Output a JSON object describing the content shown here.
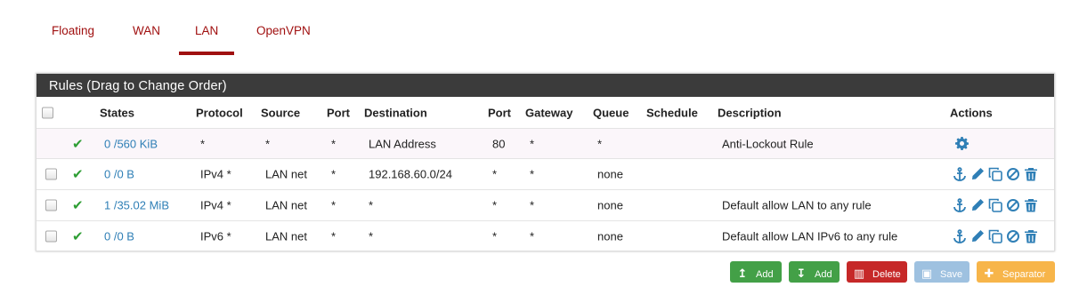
{
  "tabs": [
    {
      "label": "Floating",
      "active": false
    },
    {
      "label": "WAN",
      "active": false
    },
    {
      "label": "LAN",
      "active": true
    },
    {
      "label": "OpenVPN",
      "active": false
    }
  ],
  "panel": {
    "title": "Rules (Drag to Change Order)"
  },
  "columns": {
    "states": "States",
    "protocol": "Protocol",
    "source": "Source",
    "port": "Port",
    "destination": "Destination",
    "dest_port": "Port",
    "gateway": "Gateway",
    "queue": "Queue",
    "schedule": "Schedule",
    "description": "Description",
    "actions": "Actions"
  },
  "rows": [
    {
      "states": "0 /560 KiB",
      "protocol": "*",
      "source": "*",
      "port": "*",
      "destination": "LAN Address",
      "dest_port": "80",
      "gateway": "*",
      "queue": "*",
      "schedule": "",
      "description": "Anti-Lockout Rule",
      "actions": [
        "gear-icon"
      ],
      "has_checkbox": false
    },
    {
      "states": "0 /0 B",
      "protocol": "IPv4 *",
      "source": "LAN net",
      "port": "*",
      "destination": "192.168.60.0/24",
      "dest_port": "*",
      "gateway": "*",
      "queue": "none",
      "schedule": "",
      "description": "",
      "actions": [
        "anchor-icon",
        "pencil-icon",
        "copy-icon",
        "ban-icon",
        "trash-icon"
      ],
      "has_checkbox": true
    },
    {
      "states": "1 /35.02 MiB",
      "protocol": "IPv4 *",
      "source": "LAN net",
      "port": "*",
      "destination": "*",
      "dest_port": "*",
      "gateway": "*",
      "queue": "none",
      "schedule": "",
      "description": "Default allow LAN to any rule",
      "actions": [
        "anchor-icon",
        "pencil-icon",
        "copy-icon",
        "ban-icon",
        "trash-icon"
      ],
      "has_checkbox": true
    },
    {
      "states": "0 /0 B",
      "protocol": "IPv6 *",
      "source": "LAN net",
      "port": "*",
      "destination": "*",
      "dest_port": "*",
      "gateway": "*",
      "queue": "none",
      "schedule": "",
      "description": "Default allow LAN IPv6 to any rule",
      "actions": [
        "anchor-icon",
        "pencil-icon",
        "copy-icon",
        "ban-icon",
        "trash-icon"
      ],
      "has_checkbox": true
    }
  ],
  "buttons": {
    "add_top": "Add",
    "add_bottom": "Add",
    "delete": "Delete",
    "save": "Save",
    "separator": "Separator"
  },
  "colors": {
    "tab_accent": "#a01010",
    "panel_header": "#3b3b3b",
    "link": "#2f7fb6",
    "check": "#2e9e34",
    "add": "#43a047",
    "delete": "#c62828",
    "save": "#9ec1e0",
    "separator": "#f7b54a"
  }
}
